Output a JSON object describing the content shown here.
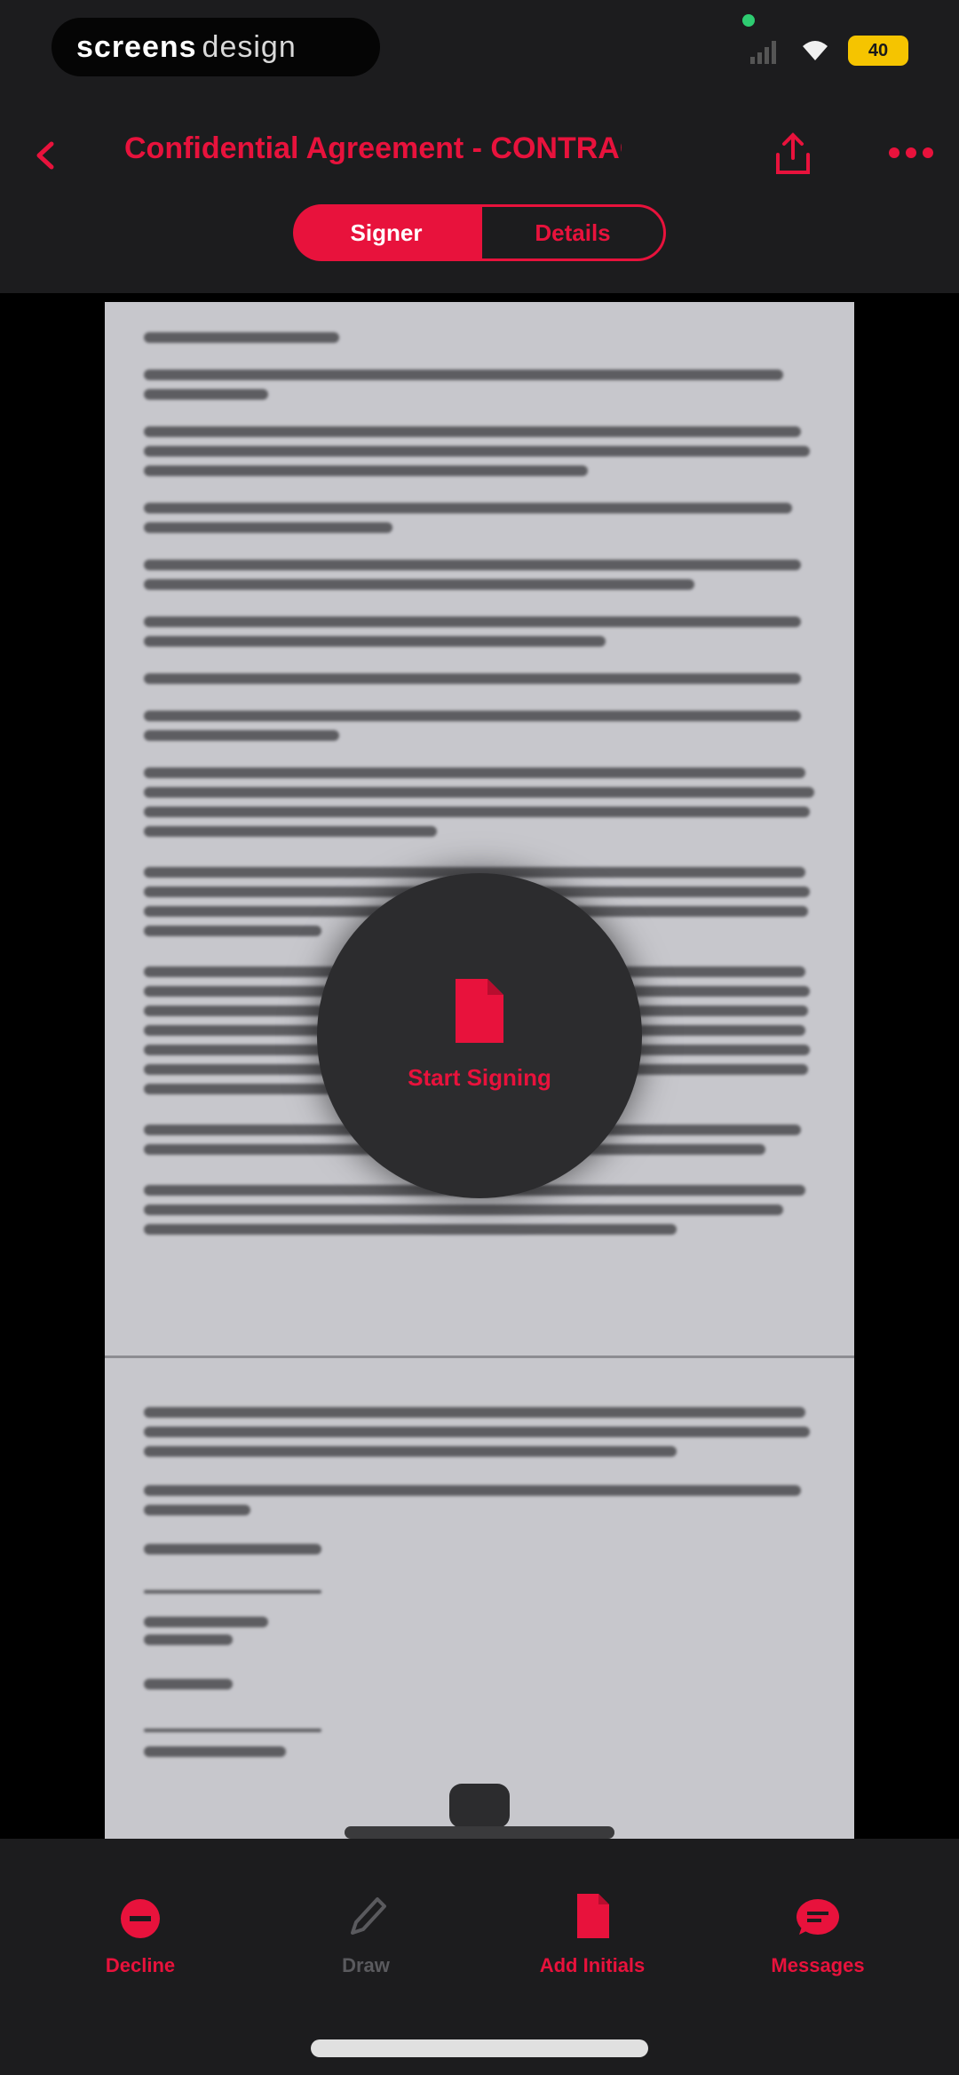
{
  "status_bar": {
    "app_name_bold": "screens",
    "app_name_thin": "design",
    "battery": "40"
  },
  "header": {
    "title": "Confidential Agreement - CONTRACT",
    "tabs": [
      {
        "label": "Signer"
      },
      {
        "label": "Details"
      }
    ]
  },
  "sign_fab": {
    "label": "Start Signing"
  },
  "bottom_nav": {
    "items": [
      {
        "label": "Decline",
        "icon": "decline-icon"
      },
      {
        "label": "Draw",
        "icon": "pen-icon"
      },
      {
        "label": "Add Initials",
        "icon": "document-icon"
      },
      {
        "label": "Messages",
        "icon": "message-icon"
      }
    ]
  },
  "colors": {
    "accent": "#e8123c",
    "chrome": "#1c1c1e",
    "page": "#c7c7cc"
  }
}
